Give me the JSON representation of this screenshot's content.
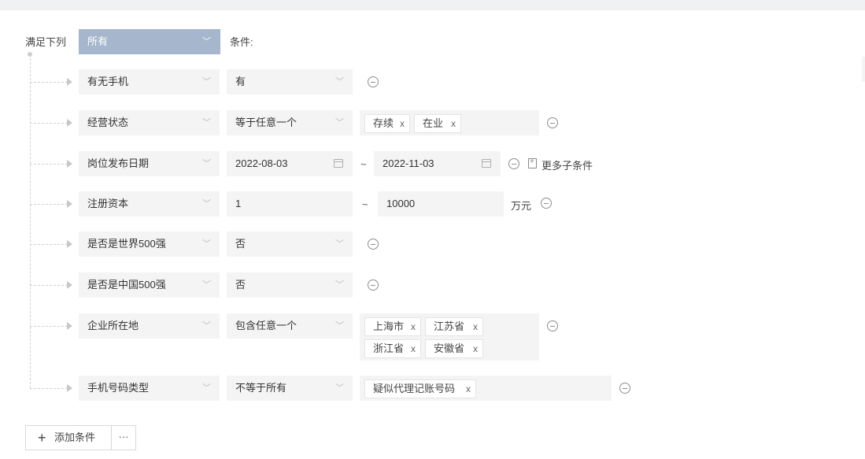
{
  "header": {
    "match_label": "满足下列",
    "match_value": "所有",
    "condition_label": "条件:"
  },
  "conditions": [
    {
      "field": "有无手机",
      "operator": "有"
    },
    {
      "field": "经营状态",
      "operator": "等于任意一个",
      "tags": [
        "存续",
        "在业"
      ]
    },
    {
      "field": "岗位发布日期",
      "start": "2022-08-03",
      "end": "2022-11-03",
      "extra": "更多子条件"
    },
    {
      "field": "注册资本",
      "min": "1",
      "max": "10000",
      "unit": "万元"
    },
    {
      "field": "是否是世界500强",
      "operator": "否"
    },
    {
      "field": "是否是中国500强",
      "operator": "否"
    },
    {
      "field": "企业所在地",
      "operator": "包含任意一个",
      "tags": [
        "上海市",
        "江苏省",
        "浙江省",
        "安徽省"
      ]
    },
    {
      "field": "手机号码类型",
      "operator": "不等于所有",
      "tags": [
        "疑似代理记账号码"
      ]
    }
  ],
  "range_separator": "~",
  "tag_remove": "x",
  "footer": {
    "add_label": "添加条件",
    "add_icon": "+",
    "more_label": "···"
  }
}
